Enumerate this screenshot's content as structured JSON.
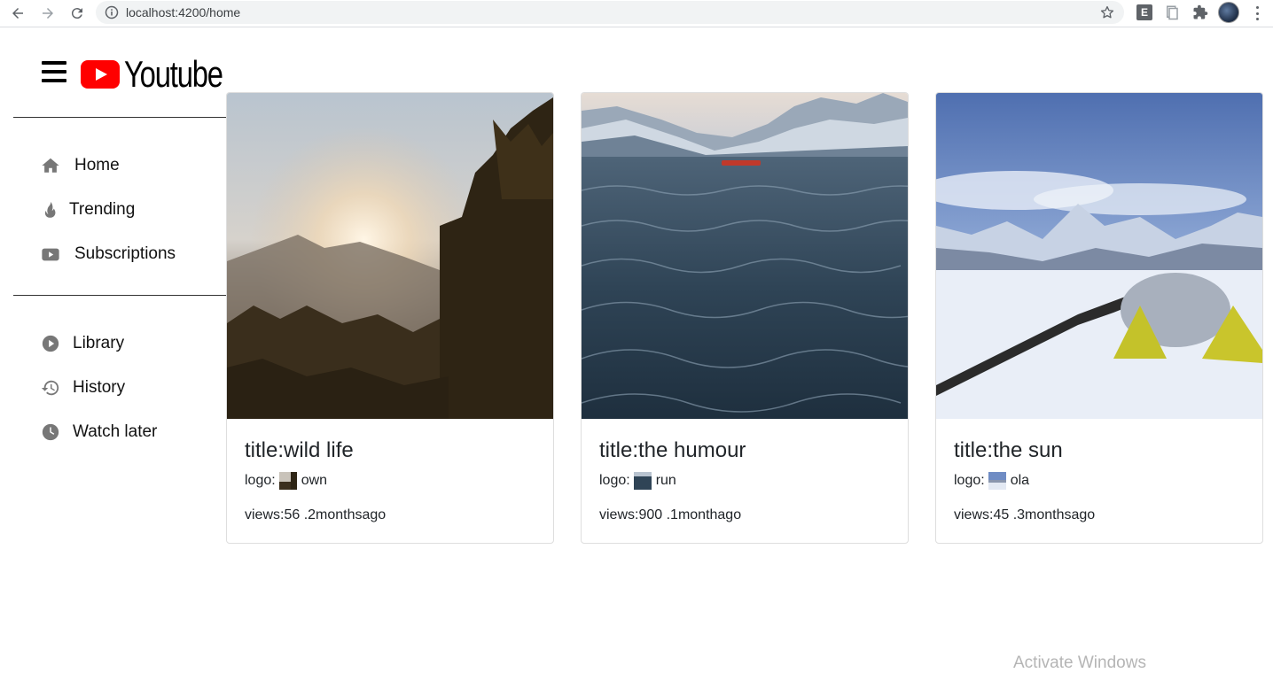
{
  "browser": {
    "url": "localhost:4200/home",
    "back_icon": "arrow-left-icon",
    "forward_icon": "arrow-right-icon",
    "reload_icon": "reload-icon",
    "extension_badge": "E"
  },
  "header": {
    "brand": "Youtube",
    "brand_color": "#ff0000"
  },
  "sidebar": {
    "primary": [
      {
        "label": "Home",
        "icon": "home-icon"
      },
      {
        "label": "Trending",
        "icon": "fire-icon"
      },
      {
        "label": "Subscriptions",
        "icon": "subscriptions-icon"
      }
    ],
    "secondary": [
      {
        "label": "Library",
        "icon": "play-circle-icon"
      },
      {
        "label": "History",
        "icon": "history-icon"
      },
      {
        "label": "Watch later",
        "icon": "clock-icon"
      }
    ]
  },
  "videos": [
    {
      "title": "title:wild life",
      "logo_label": "logo:",
      "channel": "own",
      "views": "views:56 .2monthsago"
    },
    {
      "title": "title:the humour",
      "logo_label": "logo:",
      "channel": "run",
      "views": "views:900 .1monthago"
    },
    {
      "title": "title:the sun",
      "logo_label": "logo:",
      "channel": "ola",
      "views": "views:45 .3monthsago"
    }
  ],
  "watermark": "Activate Windows"
}
